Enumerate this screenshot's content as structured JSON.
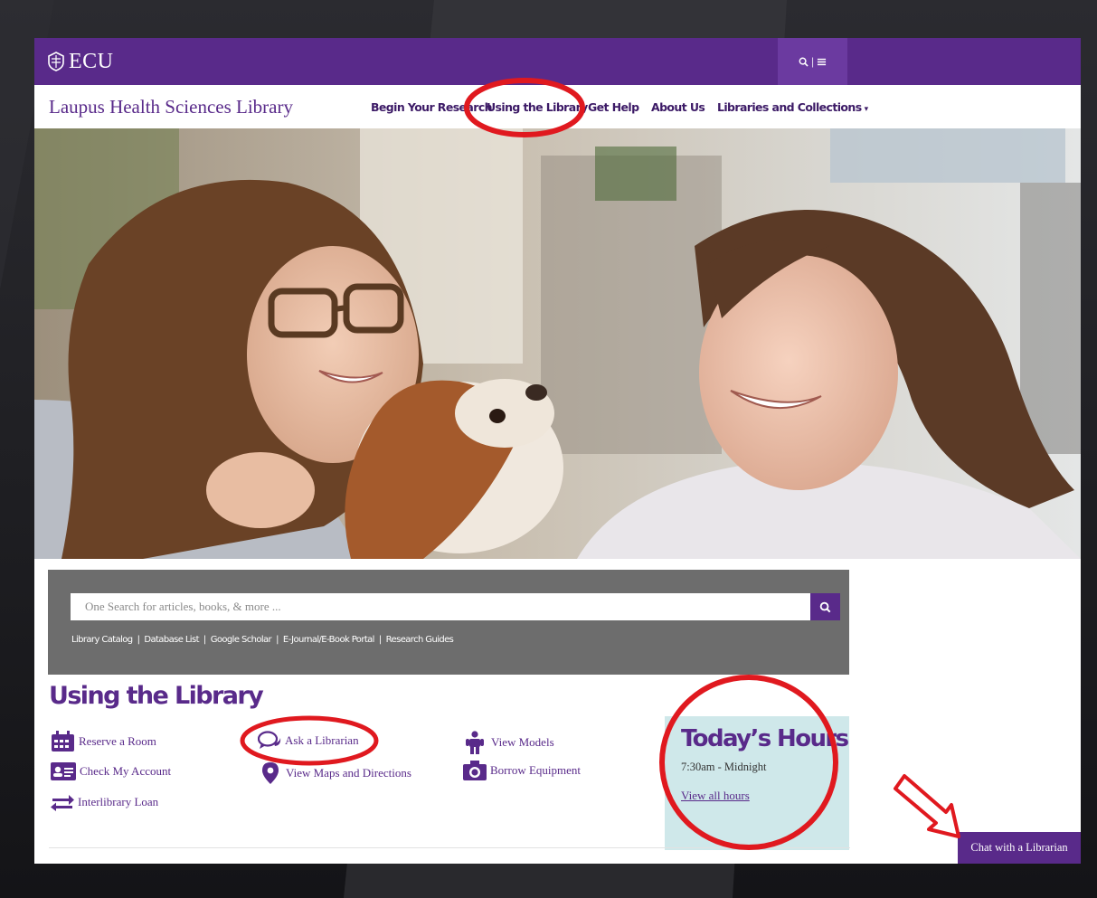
{
  "brand": {
    "wordmark": "ECU",
    "site_title": "Laupus Health Sciences Library",
    "purple": "#592a8a",
    "annotation_red": "#e0191f"
  },
  "header": {
    "menu_toggle_icons": [
      "search-icon",
      "menu-icon"
    ]
  },
  "nav": {
    "items": [
      {
        "label": "Begin Your Research"
      },
      {
        "label": "Using the Library"
      },
      {
        "label": "Get Help"
      },
      {
        "label": "About Us"
      },
      {
        "label": "Libraries and Collections",
        "has_dropdown": true
      }
    ]
  },
  "search": {
    "placeholder": "One Search for articles, books, & more ...",
    "quick_links": [
      "Library Catalog",
      "Database List",
      "Google Scholar",
      "E-Journal/E-Book Portal",
      "Research Guides"
    ],
    "separator": "|"
  },
  "section": {
    "title": "Using the Library",
    "services": [
      {
        "label": "Reserve a Room",
        "icon": "calendar-icon"
      },
      {
        "label": "Check My Account",
        "icon": "id-card-icon"
      },
      {
        "label": "Interlibrary Loan",
        "icon": "exchange-icon"
      },
      {
        "label": "Ask a Librarian",
        "icon": "chat-bubbles-icon"
      },
      {
        "label": "View Maps and Directions",
        "icon": "map-marker-icon"
      },
      {
        "label": "View Models",
        "icon": "person-icon"
      },
      {
        "label": "Borrow Equipment",
        "icon": "camera-icon"
      }
    ]
  },
  "hours": {
    "title": "Today’s Hours",
    "time": "7:30am - Midnight",
    "link": "View all hours"
  },
  "chat": {
    "label": "Chat with a Librarian"
  }
}
